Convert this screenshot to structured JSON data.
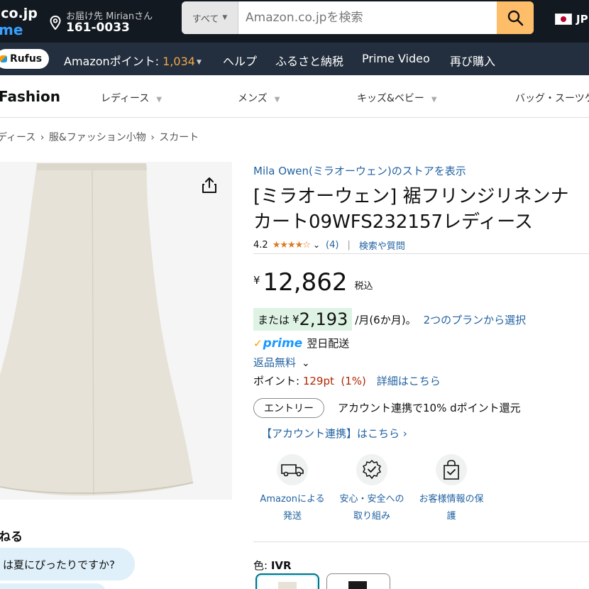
{
  "header": {
    "logo_top": ".co.jp",
    "logo_bottom": "me",
    "deliver_to": "お届け先 Mirianさん",
    "postal_code": "161-0033",
    "search_category": "すべて",
    "search_placeholder": "Amazon.co.jpを検索",
    "language": "JP"
  },
  "subnav": {
    "rufus": "Rufus",
    "points_label": "Amazonポイント: ",
    "points_value": "1,034",
    "items": [
      "ヘルプ",
      "ふるさと納税",
      "Prime Video",
      "再び購入"
    ]
  },
  "fashion": {
    "title": "Fashion",
    "categories": [
      "レディース",
      "メンズ",
      "キッズ&ベビー",
      "バッグ・スーツケ"
    ]
  },
  "breadcrumb": [
    "ディース",
    "服&ファッション小物",
    "スカート"
  ],
  "product": {
    "store": "Mila Owen(ミラオーウェン)のストアを表示",
    "title_line1": "[ミラオーウェン] 裾フリンジリネンナ",
    "title_line2": "カート09WFS232157レディース",
    "rating": "4.2",
    "stars": "★★★★☆",
    "review_count": "(4)",
    "qa_link": "検索や質問",
    "price_symbol": "¥",
    "price": "12,862",
    "tax_label": "税込",
    "installment_prefix": "または",
    "installment_symbol": "¥",
    "installment_amount": "2,193",
    "installment_term": "/月(6か月)。",
    "plans_link": "2つのプランから選択",
    "prime_word": "prime",
    "prime_delivery": "翌日配送",
    "returns": "返品無料",
    "points_label": "ポイント: ",
    "points_value": "129pt  (1%)",
    "points_details": "詳細はこちら",
    "entry_button": "エントリー",
    "dpoint_text": "アカウント連携で10% dポイント還元",
    "account_link": "【アカウント連携】はこちら ›",
    "features": [
      {
        "icon": "delivery-van-icon",
        "line1": "Amazonによる",
        "line2": "発送"
      },
      {
        "icon": "security-badge-icon",
        "line1": "安心・安全への",
        "line2": "取り組み"
      },
      {
        "icon": "lock-bag-icon",
        "line1": "お客様情報の保",
        "line2": "護"
      }
    ],
    "color_label": "色: ",
    "color_value": "IVR"
  },
  "ask": {
    "title": "ねる",
    "question": "は夏にぴったりですか?"
  },
  "colors": {
    "nav_bg": "#131921",
    "subnav_bg": "#232f3e",
    "search_button": "#febd69",
    "link": "#2162a1",
    "price_red": "#b12704",
    "prime_blue": "#1a98ff"
  }
}
